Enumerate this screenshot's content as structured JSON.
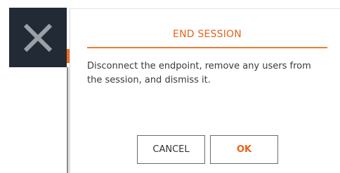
{
  "dialog": {
    "title": "END SESSION",
    "message": "Disconnect the endpoint, remove any users from the session, and dismiss it.",
    "cancel_label": "CANCEL",
    "ok_label": "OK"
  },
  "icons": {
    "close": "close-icon"
  },
  "colors": {
    "accent": "#e8621a",
    "tile_background": "#222b35",
    "icon_gray": "#9aa0a6"
  }
}
